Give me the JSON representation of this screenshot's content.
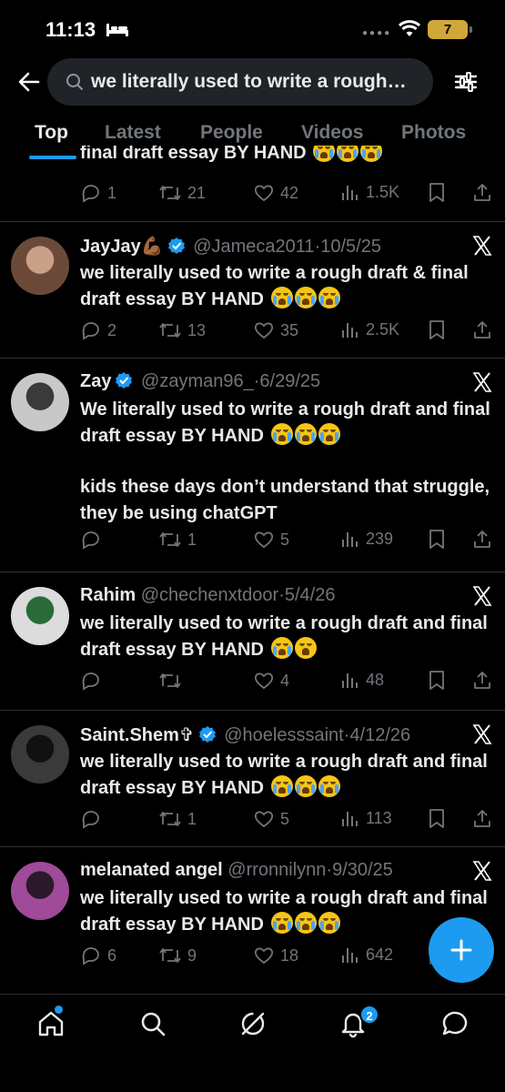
{
  "status_bar": {
    "time": "11:13",
    "battery": "7"
  },
  "search": {
    "query": "we literally used to write a rough…"
  },
  "tabs": [
    {
      "label": "Top",
      "active": true
    },
    {
      "label": "Latest",
      "active": false
    },
    {
      "label": "People",
      "active": false
    },
    {
      "label": "Videos",
      "active": false
    },
    {
      "label": "Photos",
      "active": false
    }
  ],
  "cutoff_tweet": {
    "text": "final draft essay BY HAND",
    "replies": "1",
    "reposts": "21",
    "likes": "42",
    "views": "1.5K"
  },
  "tweets": [
    {
      "name": "JayJay",
      "name_suffix": "💪🏾",
      "verified": true,
      "handle": "@Jameca2011",
      "date": "10/5/25",
      "text": "we literally used to write a rough draft & final draft essay BY HAND",
      "text2": "",
      "emoji": "😭😭😭",
      "replies": "2",
      "reposts": "13",
      "likes": "35",
      "views": "2.5K"
    },
    {
      "name": "Zay",
      "name_suffix": "",
      "verified": true,
      "handle": "@zayman96_",
      "date": "6/29/25",
      "text": "We literally used to write a rough draft and final draft essay BY HAND",
      "text2": "kids these days don’t understand that struggle, they be using chatGPT",
      "emoji": "😭😭😭",
      "replies": "",
      "reposts": "1",
      "likes": "5",
      "views": "239"
    },
    {
      "name": "Rahim",
      "name_suffix": "",
      "verified": false,
      "handle": "@chechenxtdoor",
      "date": "5/4/26",
      "text": "we literally used to write a rough draft and final draft essay BY HAND",
      "text2": "",
      "emoji": "😭🤣",
      "replies": "",
      "reposts": "",
      "likes": "4",
      "views": "48"
    },
    {
      "name": "Saint.Shem",
      "name_suffix": "✞",
      "verified": true,
      "handle": "@hoelesssaint",
      "date": "4/12/26",
      "text": "we literally used to write a rough draft and final draft essay BY HAND",
      "text2": "",
      "emoji": "😭😭😭",
      "replies": "",
      "reposts": "1",
      "likes": "5",
      "views": "113"
    },
    {
      "name": "melanated angel",
      "name_suffix": "",
      "verified": false,
      "handle": "@rronnilynn",
      "date": "9/30/25",
      "text": "we literally used to write a rough draft and final draft essay BY HAND",
      "text2": "",
      "emoji": "😭😭😭",
      "replies": "6",
      "reposts": "9",
      "likes": "18",
      "views": "642"
    }
  ],
  "bottom_nav": {
    "notifications_badge": "2"
  },
  "colors": {
    "accent": "#1d9bf0",
    "background": "#000000",
    "muted": "#71767b",
    "divider": "#2f3336"
  }
}
